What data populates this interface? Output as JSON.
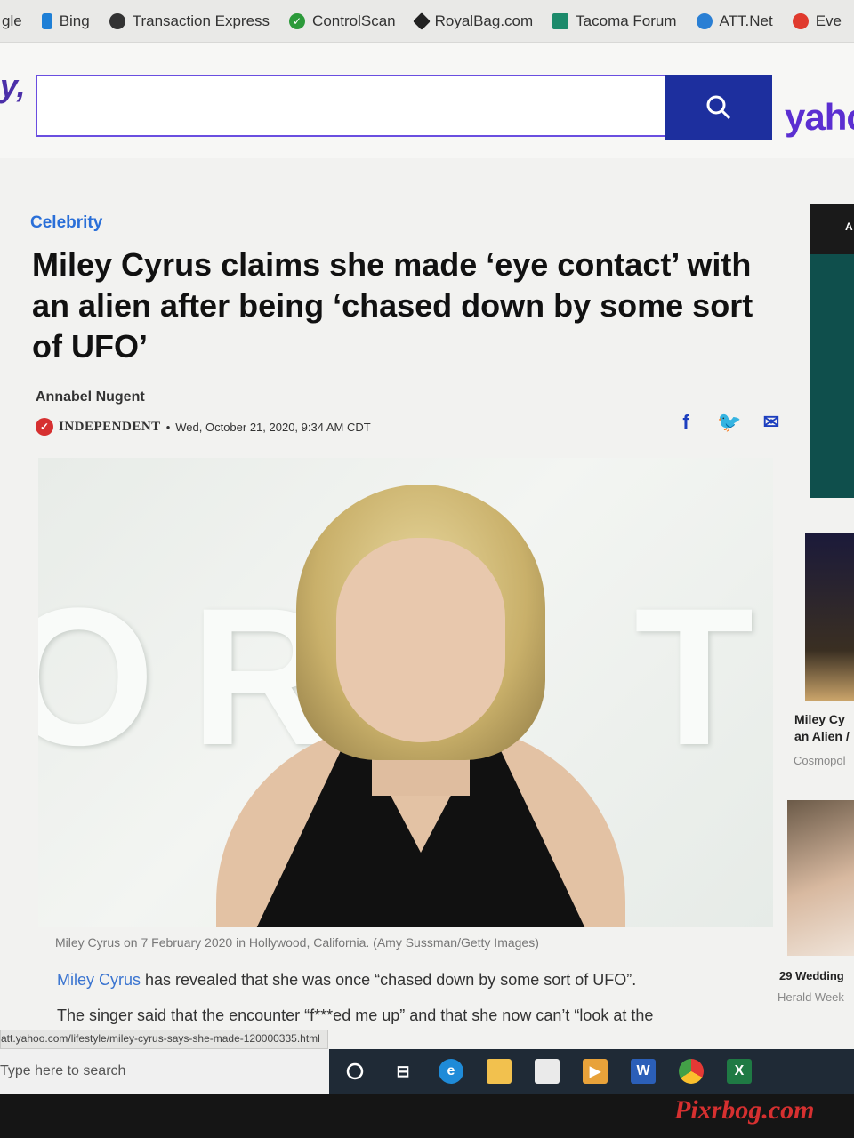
{
  "bookmarks": [
    {
      "label": "gle",
      "icon": "google-icon",
      "color": "#4285f4"
    },
    {
      "label": "Bing",
      "icon": "bing-icon",
      "color": "#1e7fd6"
    },
    {
      "label": "Transaction Express",
      "icon": "globe-icon",
      "color": "#333333"
    },
    {
      "label": "ControlScan",
      "icon": "check-circle-icon",
      "color": "#2c9a3a"
    },
    {
      "label": "RoyalBag.com",
      "icon": "diamond-icon",
      "color": "#222222"
    },
    {
      "label": "Tacoma Forum",
      "icon": "tf-icon",
      "color": "#1c8a6b"
    },
    {
      "label": "ATT.Net",
      "icon": "att-globe-icon",
      "color": "#2a7fd4"
    },
    {
      "label": "Eve",
      "icon": "red-icon",
      "color": "#e03a2e"
    }
  ],
  "header": {
    "logo_left": "y,",
    "logo_right": "yaho",
    "search_value": "",
    "search_icon": "magnifier-icon"
  },
  "article": {
    "category": "Celebrity",
    "headline": "Miley Cyrus claims she made ‘eye contact’ with an alien after being ‘chased down by some sort of UFO’",
    "author": "Annabel Nugent",
    "source": "INDEPENDENT",
    "date": "Wed, October 21, 2020, 9:34 AM CDT",
    "share": {
      "facebook": "f",
      "twitter": "🐦",
      "email": "✉"
    },
    "photo_caption": "Miley Cyrus on 7 February 2020 in Hollywood, California. (Amy Sussman/Getty Images)",
    "body_link": "Miley Cyrus",
    "body_line1_rest": " has revealed that she was once “chased down by some sort of UFO”.",
    "body_line2": "The singer said that the encounter “f***ed me up” and that she now can’t “look at the"
  },
  "status_url": "att.yahoo.com/lifestyle/miley-cyrus-says-she-made-120000335.html",
  "rail": {
    "ad_label": "A",
    "item1_title_l1": "Miley Cy",
    "item1_title_l2": "an Alien /",
    "item1_source": "Cosmopol",
    "item2_title": "29 Wedding",
    "item2_source": "Herald Week"
  },
  "taskbar": {
    "search_placeholder": "Type here to search"
  },
  "watermark": "Pixrbog.com"
}
